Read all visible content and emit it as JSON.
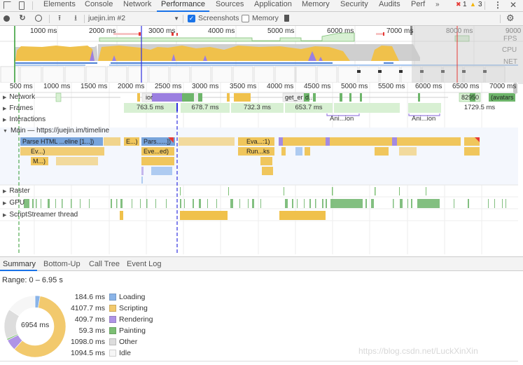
{
  "tabs": [
    {
      "label": "Elements"
    },
    {
      "label": "Console"
    },
    {
      "label": "Network"
    },
    {
      "label": "Performance",
      "active": true
    },
    {
      "label": "Sources"
    },
    {
      "label": "Application"
    },
    {
      "label": "Memory"
    },
    {
      "label": "Security"
    },
    {
      "label": "Audits"
    },
    {
      "label": "Perf"
    }
  ],
  "more_tabs_glyph": "»",
  "errors": {
    "count": "1",
    "glyph": "✖"
  },
  "warnings": {
    "count": "3",
    "glyph": "▲"
  },
  "toolbar": {
    "recording_select": "juejin.im #2",
    "screenshots_label": "Screenshots",
    "screenshots_checked": true,
    "memory_label": "Memory",
    "memory_checked": false
  },
  "overview": {
    "ticks": [
      "1000 ms",
      "2000 ms",
      "3000 ms",
      "4000 ms",
      "5000 ms",
      "6000 ms",
      "7000 ms",
      "8000 ms",
      "9000"
    ],
    "lane_labels": {
      "fps": "FPS",
      "cpu": "CPU",
      "net": "NET"
    }
  },
  "timeline": {
    "ticks": [
      "500 ms",
      "1000 ms",
      "1500 ms",
      "2000 ms",
      "2500 ms",
      "3000 ms",
      "3500 ms",
      "4000 ms",
      "4500 ms",
      "5000 ms",
      "5500 ms",
      "6000 ms",
      "6500 ms",
      "7000 ms"
    ],
    "tracks": {
      "network": "Network",
      "frames": "Frames",
      "interactions": "Interactions",
      "main": "Main — https://juejin.im/timeline",
      "raster": "Raster",
      "gpu": "GPU",
      "script_streamer": "ScriptStreamer thread"
    },
    "network_labels": [
      "ior",
      "get_er",
      "d...",
      "82950",
      "(avatars"
    ],
    "frames": [
      "763.5 ms",
      "678.7 ms",
      "732.3 ms",
      "653.7 ms",
      "1729.5 ms"
    ],
    "interactions": [
      "Ani...ion",
      "Ani...ion"
    ],
    "main_blocks": [
      "Parse HTML ...eline [1...])",
      "E...)",
      "Pars......])",
      "Eva...:1)",
      "Ev...)",
      "Eve...ed)",
      "Run...ks",
      "M...)"
    ]
  },
  "bottom_tabs": [
    {
      "label": "Summary",
      "active": true
    },
    {
      "label": "Bottom-Up"
    },
    {
      "label": "Call Tree"
    },
    {
      "label": "Event Log"
    }
  ],
  "summary": {
    "range": "Range: 0 – 6.95 s",
    "total": "6954 ms",
    "categories": [
      {
        "value": "184.6 ms",
        "name": "Loading",
        "ms": 184.6,
        "color": "#8ab4e8"
      },
      {
        "value": "4107.7 ms",
        "name": "Scripting",
        "ms": 4107.7,
        "color": "#f2c96d"
      },
      {
        "value": "409.7 ms",
        "name": "Rendering",
        "ms": 409.7,
        "color": "#af94e6"
      },
      {
        "value": "59.3 ms",
        "name": "Painting",
        "ms": 59.3,
        "color": "#7cbf74"
      },
      {
        "value": "1098.0 ms",
        "name": "Other",
        "ms": 1098.0,
        "color": "#dddddd"
      },
      {
        "value": "1094.5 ms",
        "name": "Idle",
        "ms": 1094.5,
        "color": "#f6f6f6"
      }
    ]
  },
  "watermark": "https://blog.csdn.net/LuckXinXin"
}
